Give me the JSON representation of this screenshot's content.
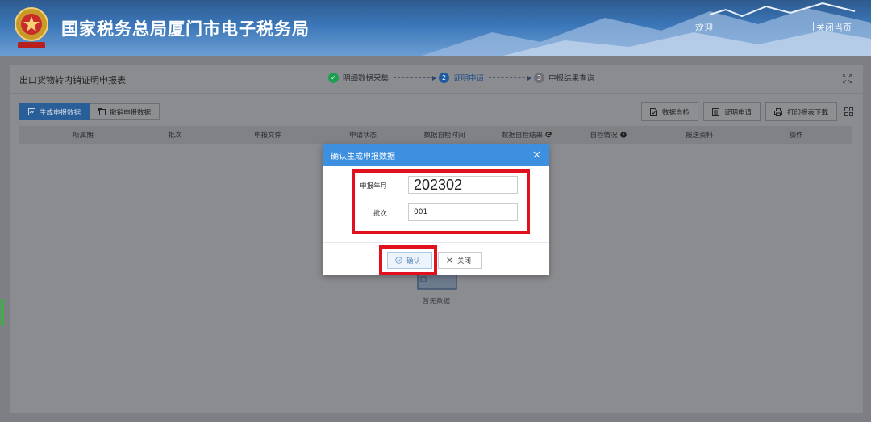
{
  "header": {
    "site_title": "国家税务总局厦门市电子税务局",
    "welcome": "欢迎",
    "close_page": "关闭当页"
  },
  "page": {
    "title": "出口货物转内销证明申报表",
    "steps": [
      {
        "label": "明细数据采集",
        "state": "done"
      },
      {
        "label": "证明申请",
        "number": "2",
        "state": "current"
      },
      {
        "label": "申报结果查询",
        "number": "3",
        "state": "todo"
      }
    ]
  },
  "tabs": [
    {
      "label": "生成申报数据",
      "active": true
    },
    {
      "label": "撤销申报数据",
      "active": false
    }
  ],
  "toolbar": {
    "data_check": "数据自检",
    "cert_apply": "证明申请",
    "print_download": "打印报表下载"
  },
  "table": {
    "columns": [
      "所属期",
      "批次",
      "申报文件",
      "申请状态",
      "数据自检时间",
      "数据自检结果",
      "自检情况",
      "报送资料",
      "操作"
    ],
    "empty_text": "暂无数据"
  },
  "modal": {
    "title": "确认生成申报数据",
    "period_label": "申报年月",
    "period_value": "202302",
    "batch_label": "批次",
    "batch_value": "001",
    "confirm_label": "确认",
    "close_label": "关闭"
  },
  "colors": {
    "modal_header": "#3d8fe0",
    "highlight": "#e1101f",
    "active_tab": "#2a5e99",
    "step_done": "#1e9f4f"
  }
}
